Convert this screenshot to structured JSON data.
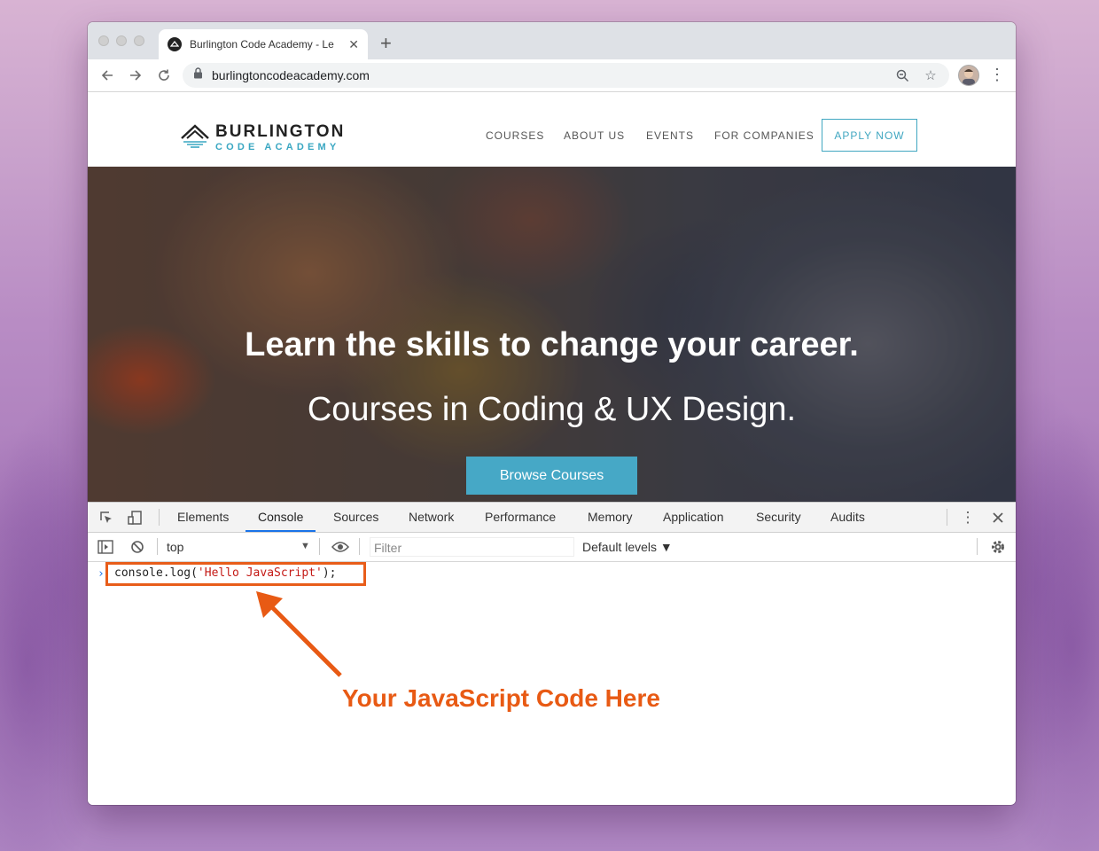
{
  "browser": {
    "tab_title": "Burlington Code Academy - Le",
    "new_tab_label": "+",
    "url": "burlingtoncodeacademy.com"
  },
  "site": {
    "logo_title": "BURLINGTON",
    "logo_subtitle": "CODE ACADEMY",
    "nav": [
      "COURSES",
      "ABOUT US",
      "EVENTS",
      "FOR COMPANIES"
    ],
    "apply_label": "APPLY NOW",
    "hero_title": "Learn the skills to change your career.",
    "hero_subtitle": "Courses in Coding & UX Design.",
    "browse_label": "Browse Courses"
  },
  "devtools": {
    "tabs": [
      "Elements",
      "Console",
      "Sources",
      "Network",
      "Performance",
      "Memory",
      "Application",
      "Security",
      "Audits"
    ],
    "active_tab": "Console",
    "context": "top",
    "filter_placeholder": "Filter",
    "levels": "Default levels ▼",
    "prompt": "›",
    "code_prefix": "console.log(",
    "code_string": "'Hello JavaScript'",
    "code_suffix": ");"
  },
  "annotation": {
    "text": "Your JavaScript Code Here",
    "color": "#e85a14"
  },
  "colors": {
    "accent": "#41a7c1",
    "devtools_active": "#1a73e8"
  }
}
